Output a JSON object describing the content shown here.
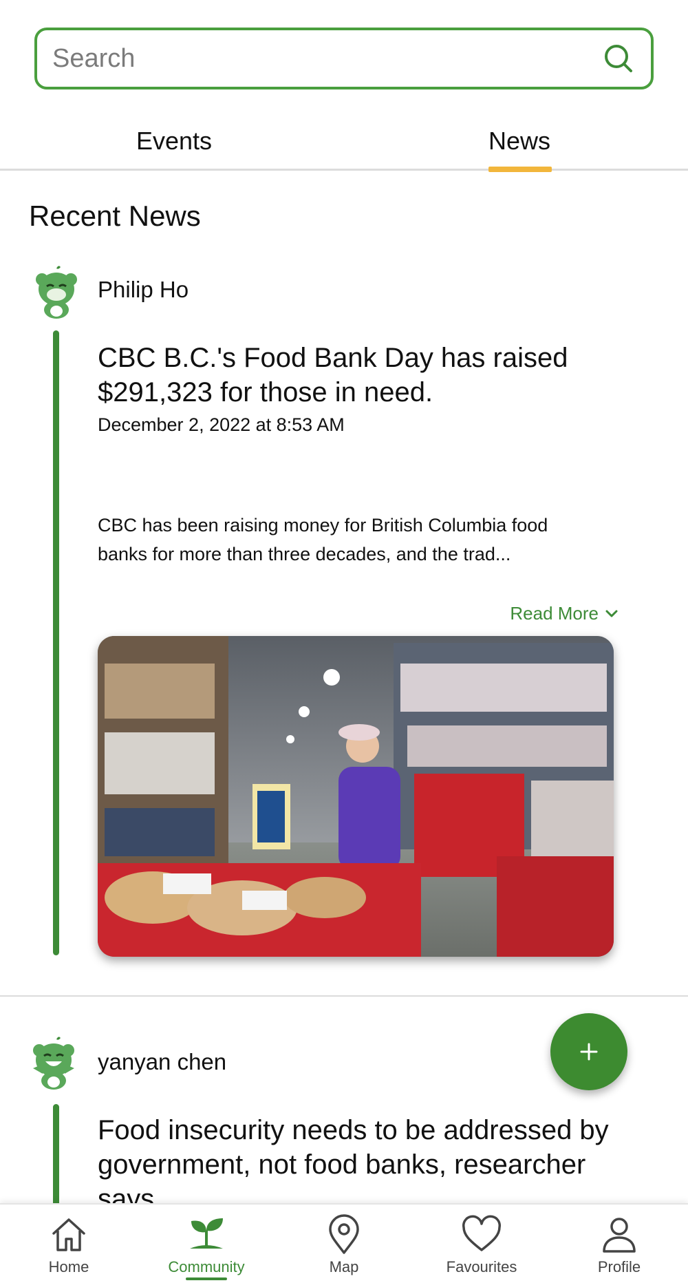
{
  "search": {
    "placeholder": "Search",
    "value": ""
  },
  "tabs": [
    {
      "label": "Events",
      "active": false
    },
    {
      "label": "News",
      "active": true
    }
  ],
  "section_title": "Recent News",
  "posts": [
    {
      "author": "Philip Ho",
      "headline": "CBC B.C.'s Food Bank Day has raised $291,323 for those in need.",
      "date": "December 2, 2022 at 8:53 AM",
      "excerpt": "CBC has been raising money for British Columbia food banks for more than three decades, and the trad...",
      "read_more": "Read More"
    },
    {
      "author": "yanyan chen",
      "headline": "Food insecurity needs to be addressed by government, not food banks, researcher says"
    }
  ],
  "fab": {
    "icon": "plus-icon"
  },
  "bottom_nav": [
    {
      "label": "Home",
      "icon": "home-icon",
      "active": false
    },
    {
      "label": "Community",
      "icon": "sprout-icon",
      "active": true
    },
    {
      "label": "Map",
      "icon": "map-pin-icon",
      "active": false
    },
    {
      "label": "Favourites",
      "icon": "heart-icon",
      "active": false
    },
    {
      "label": "Profile",
      "icon": "person-icon",
      "active": false
    }
  ],
  "colors": {
    "brand_green": "#3d8b37",
    "tab_indicator": "#f2b63b",
    "search_border": "#4a9f3e"
  }
}
